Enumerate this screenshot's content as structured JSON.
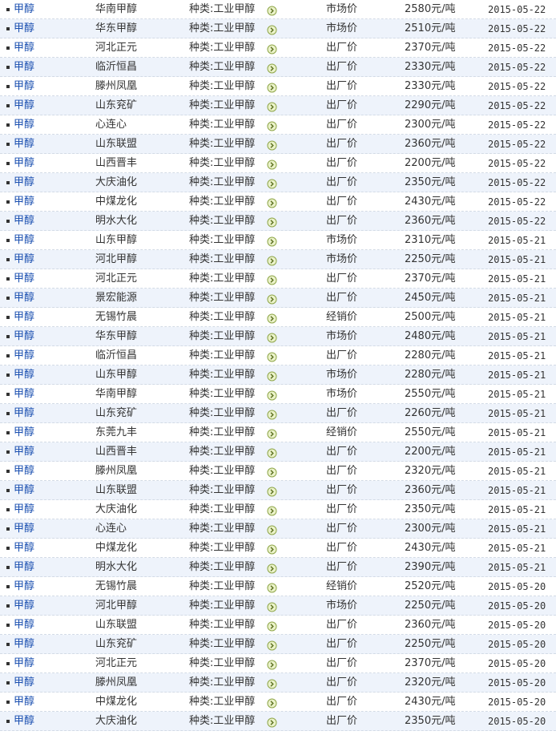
{
  "category_label": "种类:",
  "rows": [
    {
      "product": "甲醇",
      "company": "华南甲醇",
      "category": "工业甲醇",
      "price_type": "市场价",
      "price": "2580元/吨",
      "date": "2015-05-22"
    },
    {
      "product": "甲醇",
      "company": "华东甲醇",
      "category": "工业甲醇",
      "price_type": "市场价",
      "price": "2510元/吨",
      "date": "2015-05-22"
    },
    {
      "product": "甲醇",
      "company": "河北正元",
      "category": "工业甲醇",
      "price_type": "出厂价",
      "price": "2370元/吨",
      "date": "2015-05-22"
    },
    {
      "product": "甲醇",
      "company": "临沂恒昌",
      "category": "工业甲醇",
      "price_type": "出厂价",
      "price": "2330元/吨",
      "date": "2015-05-22"
    },
    {
      "product": "甲醇",
      "company": "滕州凤凰",
      "category": "工业甲醇",
      "price_type": "出厂价",
      "price": "2330元/吨",
      "date": "2015-05-22"
    },
    {
      "product": "甲醇",
      "company": "山东兖矿",
      "category": "工业甲醇",
      "price_type": "出厂价",
      "price": "2290元/吨",
      "date": "2015-05-22"
    },
    {
      "product": "甲醇",
      "company": "心连心",
      "category": "工业甲醇",
      "price_type": "出厂价",
      "price": "2300元/吨",
      "date": "2015-05-22"
    },
    {
      "product": "甲醇",
      "company": "山东联盟",
      "category": "工业甲醇",
      "price_type": "出厂价",
      "price": "2360元/吨",
      "date": "2015-05-22"
    },
    {
      "product": "甲醇",
      "company": "山西晋丰",
      "category": "工业甲醇",
      "price_type": "出厂价",
      "price": "2200元/吨",
      "date": "2015-05-22"
    },
    {
      "product": "甲醇",
      "company": "大庆油化",
      "category": "工业甲醇",
      "price_type": "出厂价",
      "price": "2350元/吨",
      "date": "2015-05-22"
    },
    {
      "product": "甲醇",
      "company": "中煤龙化",
      "category": "工业甲醇",
      "price_type": "出厂价",
      "price": "2430元/吨",
      "date": "2015-05-22"
    },
    {
      "product": "甲醇",
      "company": "明水大化",
      "category": "工业甲醇",
      "price_type": "出厂价",
      "price": "2360元/吨",
      "date": "2015-05-22"
    },
    {
      "product": "甲醇",
      "company": "山东甲醇",
      "category": "工业甲醇",
      "price_type": "市场价",
      "price": "2310元/吨",
      "date": "2015-05-21"
    },
    {
      "product": "甲醇",
      "company": "河北甲醇",
      "category": "工业甲醇",
      "price_type": "市场价",
      "price": "2250元/吨",
      "date": "2015-05-21"
    },
    {
      "product": "甲醇",
      "company": "河北正元",
      "category": "工业甲醇",
      "price_type": "出厂价",
      "price": "2370元/吨",
      "date": "2015-05-21"
    },
    {
      "product": "甲醇",
      "company": "景宏能源",
      "category": "工业甲醇",
      "price_type": "出厂价",
      "price": "2450元/吨",
      "date": "2015-05-21"
    },
    {
      "product": "甲醇",
      "company": "无锡竹晨",
      "category": "工业甲醇",
      "price_type": "经销价",
      "price": "2500元/吨",
      "date": "2015-05-21"
    },
    {
      "product": "甲醇",
      "company": "华东甲醇",
      "category": "工业甲醇",
      "price_type": "市场价",
      "price": "2480元/吨",
      "date": "2015-05-21"
    },
    {
      "product": "甲醇",
      "company": "临沂恒昌",
      "category": "工业甲醇",
      "price_type": "出厂价",
      "price": "2280元/吨",
      "date": "2015-05-21"
    },
    {
      "product": "甲醇",
      "company": "山东甲醇",
      "category": "工业甲醇",
      "price_type": "市场价",
      "price": "2280元/吨",
      "date": "2015-05-21"
    },
    {
      "product": "甲醇",
      "company": "华南甲醇",
      "category": "工业甲醇",
      "price_type": "市场价",
      "price": "2550元/吨",
      "date": "2015-05-21"
    },
    {
      "product": "甲醇",
      "company": "山东兖矿",
      "category": "工业甲醇",
      "price_type": "出厂价",
      "price": "2260元/吨",
      "date": "2015-05-21"
    },
    {
      "product": "甲醇",
      "company": "东莞九丰",
      "category": "工业甲醇",
      "price_type": "经销价",
      "price": "2550元/吨",
      "date": "2015-05-21"
    },
    {
      "product": "甲醇",
      "company": "山西晋丰",
      "category": "工业甲醇",
      "price_type": "出厂价",
      "price": "2200元/吨",
      "date": "2015-05-21"
    },
    {
      "product": "甲醇",
      "company": "滕州凤凰",
      "category": "工业甲醇",
      "price_type": "出厂价",
      "price": "2320元/吨",
      "date": "2015-05-21"
    },
    {
      "product": "甲醇",
      "company": "山东联盟",
      "category": "工业甲醇",
      "price_type": "出厂价",
      "price": "2360元/吨",
      "date": "2015-05-21"
    },
    {
      "product": "甲醇",
      "company": "大庆油化",
      "category": "工业甲醇",
      "price_type": "出厂价",
      "price": "2350元/吨",
      "date": "2015-05-21"
    },
    {
      "product": "甲醇",
      "company": "心连心",
      "category": "工业甲醇",
      "price_type": "出厂价",
      "price": "2300元/吨",
      "date": "2015-05-21"
    },
    {
      "product": "甲醇",
      "company": "中煤龙化",
      "category": "工业甲醇",
      "price_type": "出厂价",
      "price": "2430元/吨",
      "date": "2015-05-21"
    },
    {
      "product": "甲醇",
      "company": "明水大化",
      "category": "工业甲醇",
      "price_type": "出厂价",
      "price": "2390元/吨",
      "date": "2015-05-21"
    },
    {
      "product": "甲醇",
      "company": "无锡竹晨",
      "category": "工业甲醇",
      "price_type": "经销价",
      "price": "2520元/吨",
      "date": "2015-05-20"
    },
    {
      "product": "甲醇",
      "company": "河北甲醇",
      "category": "工业甲醇",
      "price_type": "市场价",
      "price": "2250元/吨",
      "date": "2015-05-20"
    },
    {
      "product": "甲醇",
      "company": "山东联盟",
      "category": "工业甲醇",
      "price_type": "出厂价",
      "price": "2360元/吨",
      "date": "2015-05-20"
    },
    {
      "product": "甲醇",
      "company": "山东兖矿",
      "category": "工业甲醇",
      "price_type": "出厂价",
      "price": "2250元/吨",
      "date": "2015-05-20"
    },
    {
      "product": "甲醇",
      "company": "河北正元",
      "category": "工业甲醇",
      "price_type": "出厂价",
      "price": "2370元/吨",
      "date": "2015-05-20"
    },
    {
      "product": "甲醇",
      "company": "滕州凤凰",
      "category": "工业甲醇",
      "price_type": "出厂价",
      "price": "2320元/吨",
      "date": "2015-05-20"
    },
    {
      "product": "甲醇",
      "company": "中煤龙化",
      "category": "工业甲醇",
      "price_type": "出厂价",
      "price": "2430元/吨",
      "date": "2015-05-20"
    },
    {
      "product": "甲醇",
      "company": "大庆油化",
      "category": "工业甲醇",
      "price_type": "出厂价",
      "price": "2350元/吨",
      "date": "2015-05-20"
    }
  ],
  "icons": {
    "arrow": "circle-arrow-right-icon",
    "bullet": "square-bullet-icon"
  },
  "colors": {
    "link": "#1a4fb0",
    "alt_row": "#eef3fb",
    "divider": "#d3dbe6",
    "arrow_fill": "#eaf2c8",
    "arrow_stroke": "#8fa64a"
  }
}
